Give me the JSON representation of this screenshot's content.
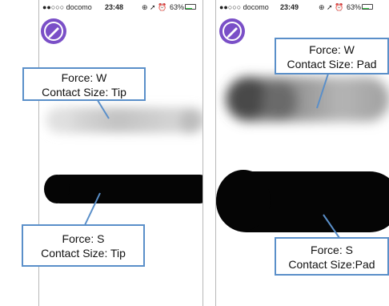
{
  "colors": {
    "panel_border": "#b9b9b9",
    "callout_border": "#5a8fc9",
    "leader_line": "#5a8fc9",
    "app_icon": "#7a4fc7",
    "battery": "#2ecc40"
  },
  "left_screen": {
    "status": {
      "carrier": "●●○○○ docomo",
      "time": "23:48",
      "battery": "63%",
      "battery_level": 0.63
    },
    "app_icon": "pen-icon",
    "callout_top": {
      "force": "Force: W",
      "contact": "Contact Size: Tip"
    },
    "callout_bottom": {
      "force": "Force: S",
      "contact": "Contact Size: Tip"
    }
  },
  "right_screen": {
    "status": {
      "carrier": "●●○○○ docomo",
      "time": "23:49",
      "battery": "63%",
      "battery_level": 0.63
    },
    "app_icon": "pen-icon",
    "callout_top": {
      "force": "Force: W",
      "contact": "Contact Size: Pad"
    },
    "callout_bottom": {
      "force": "Force: S",
      "contact": "Contact Size:Pad"
    }
  }
}
